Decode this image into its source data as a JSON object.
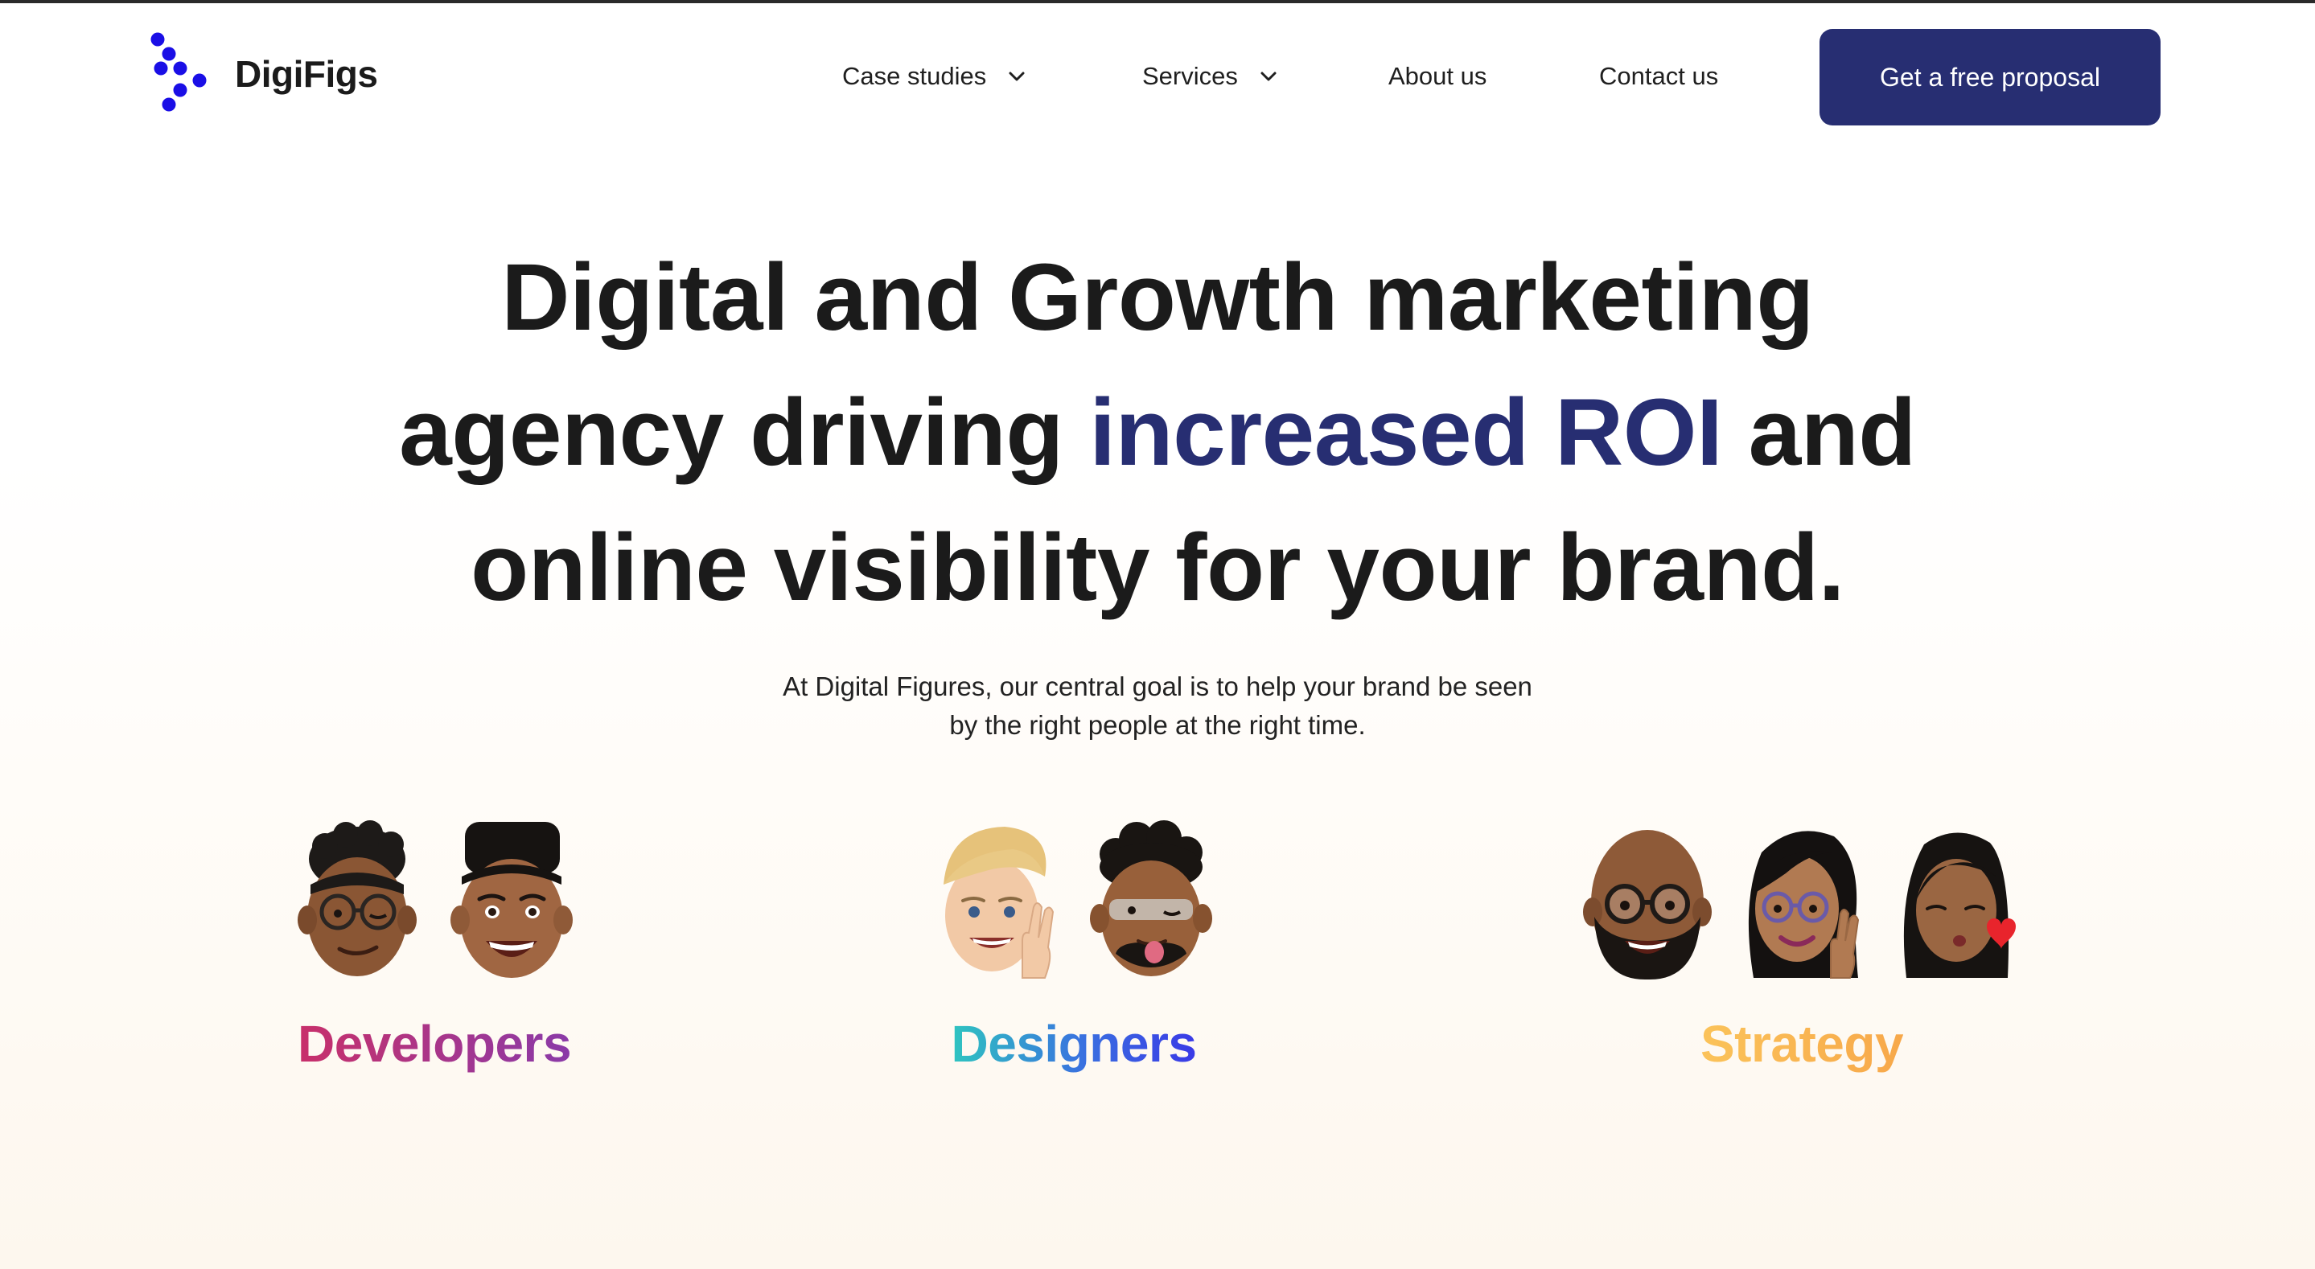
{
  "header": {
    "logo_text": "DigiFigs",
    "logo_icon": "dots-logo-icon",
    "nav": [
      {
        "label": "Case studies",
        "has_dropdown": true
      },
      {
        "label": "Services",
        "has_dropdown": true
      },
      {
        "label": "About us",
        "has_dropdown": false
      },
      {
        "label": "Contact us",
        "has_dropdown": false
      }
    ],
    "cta_label": "Get a free proposal"
  },
  "hero": {
    "headline": {
      "line1": "Digital and Growth marketing",
      "line2_prefix": "agency driving ",
      "line2_accent": "increased ROI",
      "line2_suffix": " and",
      "line3": "online visibility for your brand."
    },
    "subtitle": {
      "line1": "At Digital Figures, our central goal is to help your brand be seen",
      "line2": "by the right people at the right time."
    }
  },
  "teams": [
    {
      "label": "Developers",
      "avatars": [
        "memoji-glasses-wink",
        "memoji-flat-top"
      ]
    },
    {
      "label": "Designers",
      "avatars": [
        "memoji-blonde-peace",
        "memoji-curly-tongue"
      ]
    },
    {
      "label": "Strategy",
      "avatars": [
        "memoji-bald-beard-glasses",
        "memoji-woman-glasses",
        "memoji-woman-heart-kiss"
      ]
    }
  ],
  "colors": {
    "brand_navy": "#272e72",
    "logo_blue": "#1a0ee6",
    "developers_gradient": [
      "#c8306a",
      "#8a3aa8"
    ],
    "designers_gradient": [
      "#2fc4c0",
      "#3a3ae6"
    ],
    "strategy_gradient": [
      "#fbc35a",
      "#f7a84a"
    ]
  }
}
